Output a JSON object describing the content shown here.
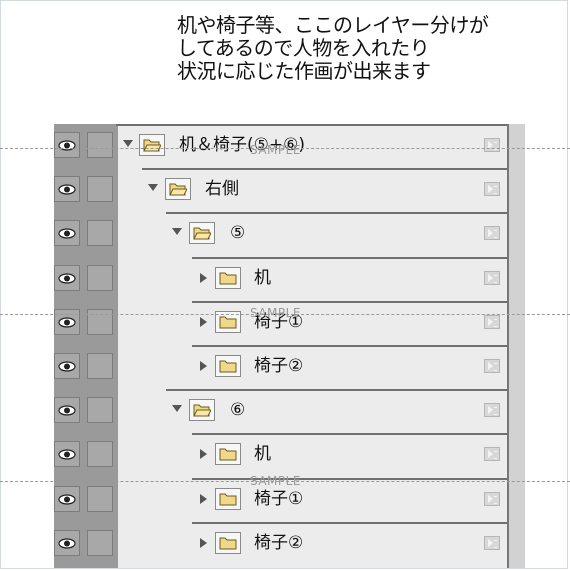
{
  "caption": {
    "line1": "机や椅子等、ここのレイヤー分けが",
    "line2": "してあるので人物を入れたり",
    "line3": "状況に応じた作画が出来ます"
  },
  "layers": [
    {
      "label": "机＆椅子(⑤+⑥)",
      "depth": 0,
      "expanded": true,
      "visible": true
    },
    {
      "label": "右側",
      "depth": 1,
      "expanded": true,
      "visible": true
    },
    {
      "label": "⑤",
      "depth": 2,
      "expanded": true,
      "visible": true
    },
    {
      "label": "机",
      "depth": 3,
      "expanded": false,
      "visible": true
    },
    {
      "label": "椅子①",
      "depth": 3,
      "expanded": false,
      "visible": true
    },
    {
      "label": "椅子②",
      "depth": 3,
      "expanded": false,
      "visible": true
    },
    {
      "label": "⑥",
      "depth": 2,
      "expanded": true,
      "visible": true
    },
    {
      "label": "机",
      "depth": 3,
      "expanded": false,
      "visible": true
    },
    {
      "label": "椅子①",
      "depth": 3,
      "expanded": false,
      "visible": true
    },
    {
      "label": "椅子②",
      "depth": 3,
      "expanded": false,
      "visible": true
    }
  ],
  "watermark": {
    "text": "SAMPLE"
  },
  "colors": {
    "panel": "#ececec",
    "gutter": "#9a9a9a",
    "folder": "#f0d88a"
  }
}
